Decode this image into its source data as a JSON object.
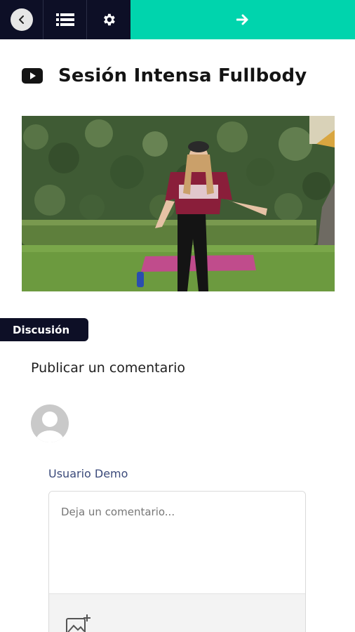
{
  "topbar": {
    "back_icon": "chevron-left-icon",
    "list_icon": "list-icon",
    "settings_icon": "gear-icon",
    "next_icon": "arrow-right-icon",
    "colors": {
      "dark": "#0d0f26",
      "accent": "#00d4ad"
    }
  },
  "lesson": {
    "icon": "youtube-play-icon",
    "title": "Sesión Intensa Fullbody"
  },
  "discussion": {
    "badge_label": "Discusión",
    "post_heading": "Publicar un comentario",
    "user_name": "Usuario Demo",
    "comment_placeholder": "Deja un comentario...",
    "image_icon": "add-image-icon"
  }
}
